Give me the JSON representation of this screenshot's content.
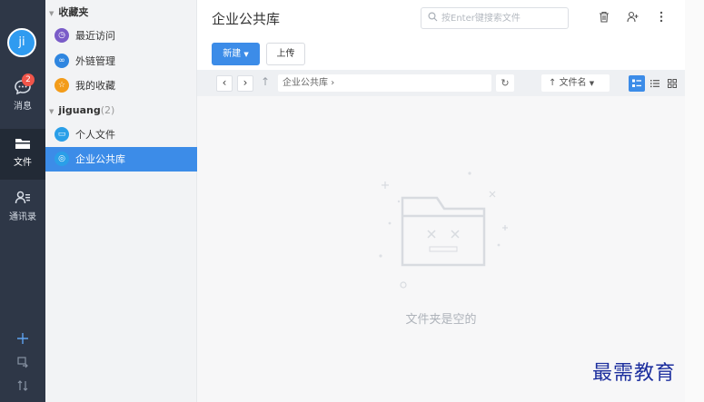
{
  "rail": {
    "avatar_text": "ji",
    "messages": {
      "label": "消息",
      "badge": "2",
      "icon": "chat-bubble-icon"
    },
    "files": {
      "label": "文件",
      "icon": "folder-icon"
    },
    "contacts": {
      "label": "通讯录",
      "icon": "contacts-icon"
    },
    "tools": [
      "plus-icon",
      "sync-icon",
      "transfer-icon"
    ]
  },
  "panel": {
    "favorites_title": "收藏夹",
    "favorites": [
      {
        "label": "最近访问",
        "icon": "recent-icon",
        "color": "#7a5cc8"
      },
      {
        "label": "外链管理",
        "icon": "link-icon",
        "color": "#2f86e0"
      },
      {
        "label": "我的收藏",
        "icon": "star-icon",
        "color": "#f39c1a"
      }
    ],
    "account_title": "jiguang",
    "account_count": "(2)",
    "account_items": [
      {
        "label": "个人文件",
        "icon": "personal-folder-icon",
        "color": "#2a9fe8"
      },
      {
        "label": "企业公共库",
        "icon": "public-library-icon",
        "color": "#2a9fe8"
      }
    ]
  },
  "main": {
    "title": "企业公共库",
    "search_placeholder": "按Enter键搜索文件",
    "new_button": "新建",
    "upload_button": "上传",
    "path": "企业公共库",
    "sort_label": "文件名",
    "empty_text": "文件夹是空的"
  },
  "watermark": "最需教育",
  "colors": {
    "accent": "#3c8ce8",
    "rail": "#2e3747",
    "badge": "#f0554a"
  }
}
